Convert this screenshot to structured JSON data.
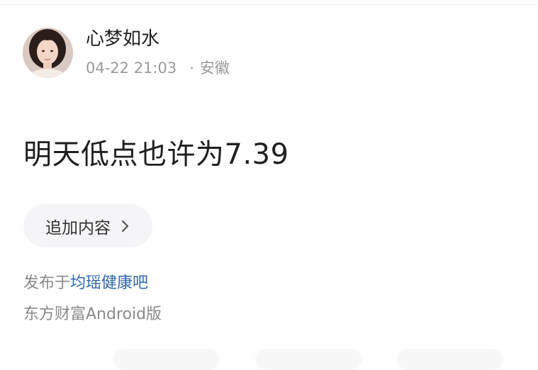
{
  "post": {
    "author": "心梦如水",
    "date": "04-22 21:03",
    "separator": "·",
    "location": "安徽",
    "content": "明天低点也许为7.39",
    "append_label": "追加内容",
    "published_prefix": "发布于",
    "bar_name": "均瑶健康吧",
    "client": "东方财富Android版"
  },
  "colors": {
    "link": "#2f66b0",
    "muted": "#9a9a9a",
    "text": "#1f1f1f"
  }
}
